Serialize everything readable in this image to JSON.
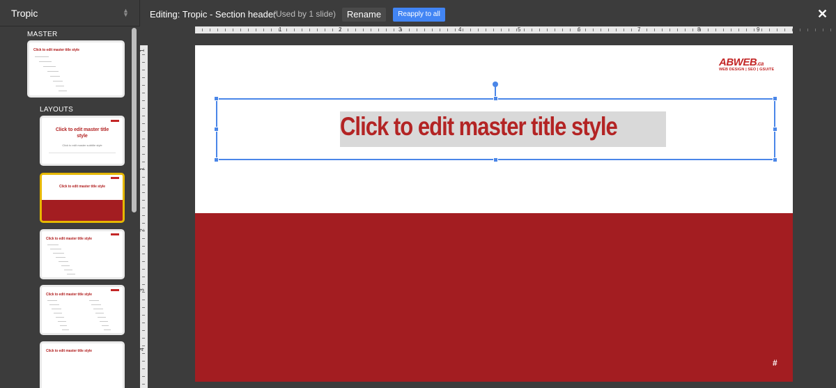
{
  "left_panel": {
    "theme_name": "Tropic",
    "master_label": "MASTER",
    "layouts_label": "LAYOUTS",
    "master_thumb_title": "Click to edit master title style",
    "layout_thumbs": [
      {
        "title": "Click to edit master title style",
        "subtitle": "Click to edit master subtitle style"
      },
      {
        "title": "Click to edit master title style"
      },
      {
        "title": "Click to edit master title style"
      },
      {
        "title": "Click to edit master title style"
      },
      {
        "title": "Click to edit master title style"
      }
    ]
  },
  "top_bar": {
    "editing_title": "Editing: Tropic - Section header",
    "usage_note": "(Used by 1 slide)",
    "rename_label": "Rename",
    "reapply_label": "Reapply to all",
    "close_glyph": "✕"
  },
  "ruler": {
    "horizontal_numbers": [
      "1",
      "2",
      "3",
      "4",
      "5",
      "6",
      "7",
      "8",
      "9"
    ],
    "vertical_numbers": [
      "1",
      "1",
      "2",
      "3",
      "4"
    ]
  },
  "slide": {
    "title_placeholder": "Click to edit master title style",
    "logo_text": "ABWEB",
    "logo_suffix": ".ca",
    "logo_tagline": "WEB DESIGN | SEO | GSUITE",
    "slide_number_symbol": "#"
  },
  "colors": {
    "accent_red": "#a31d21",
    "title_red": "#b32424",
    "selection_blue": "#4a86e8",
    "reapply_blue": "#4285f4",
    "selected_thumb_border": "#e6b800",
    "chrome_dark": "#3c3c3c"
  },
  "icons": {
    "theme_select": "up-down-arrows-icon",
    "close": "close-icon"
  }
}
